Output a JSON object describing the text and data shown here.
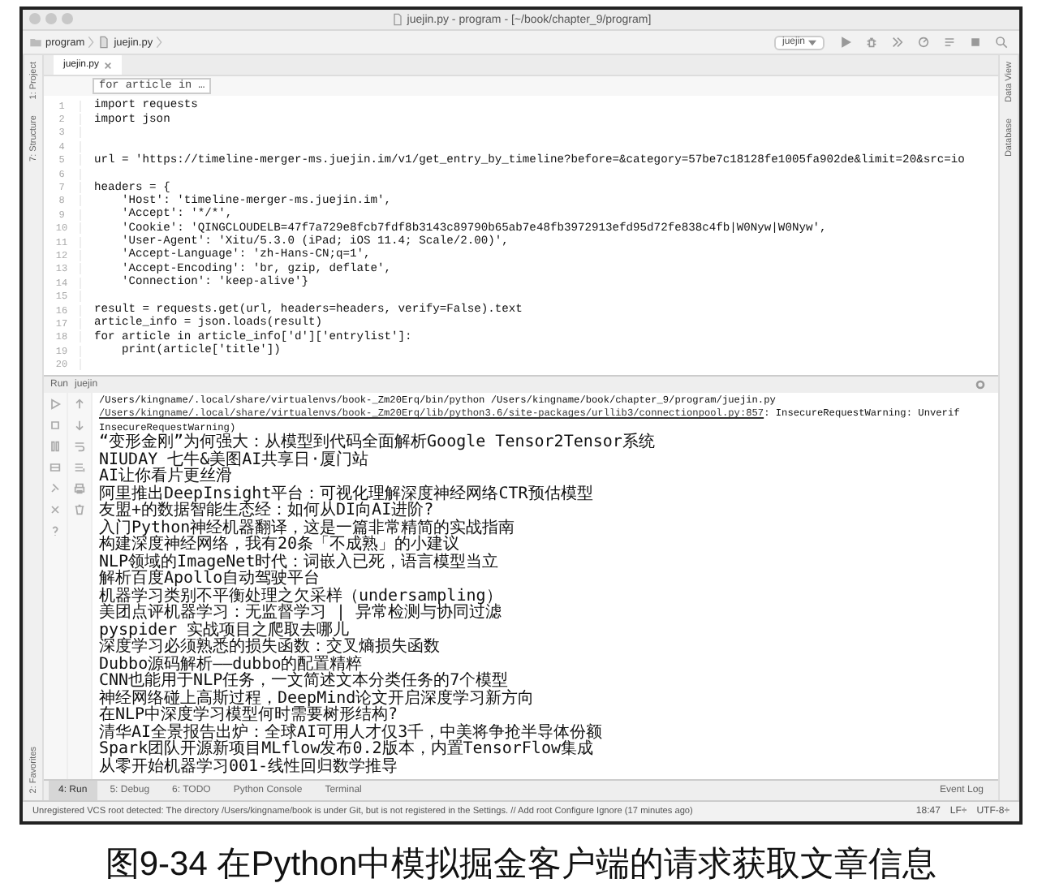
{
  "window": {
    "title": "juejin.py - program - [~/book/chapter_9/program]"
  },
  "breadcrumbs": [
    "program",
    "juejin.py"
  ],
  "run_config": "juejin",
  "left_tool_tabs": [
    "1: Project",
    "7: Structure"
  ],
  "left_bottom_tabs": [
    "2: Favorites"
  ],
  "right_tool_tabs": [
    "Data View",
    "Database"
  ],
  "editor_tabs": [
    {
      "label": "juejin.py",
      "selected": true
    }
  ],
  "breadcrumb_hint": "for article in …",
  "code_lines": [
    {
      "number": "1",
      "text": "import requests"
    },
    {
      "number": "2",
      "text": "import json"
    },
    {
      "number": "3"
    },
    {
      "number": "4"
    },
    {
      "number": "5",
      "text": "url = 'https://timeline-merger-ms.juejin.im/v1/get_entry_by_timeline?before=&category=57be7c18128fe1005fa902de&limit=20&src=io"
    },
    {
      "number": "6"
    },
    {
      "number": "7",
      "text": "headers = {"
    },
    {
      "number": "8",
      "text": "    'Host': 'timeline-merger-ms.juejin.im',"
    },
    {
      "number": "9",
      "text": "    'Accept': '*/*',"
    },
    {
      "number": "10",
      "text": "    'Cookie': 'QINGCLOUDELB=47f7a729e8fcb7fdf8b3143c89790b65ab7e48fb3972913efd95d72fe838c4fb|W0Nyw|W0Nyw',"
    },
    {
      "number": "11",
      "text": "    'User-Agent': 'Xitu/5.3.0 (iPad; iOS 11.4; Scale/2.00)',"
    },
    {
      "number": "12",
      "text": "    'Accept-Language': 'zh-Hans-CN;q=1',"
    },
    {
      "number": "13",
      "text": "    'Accept-Encoding': 'br, gzip, deflate',"
    },
    {
      "number": "14",
      "text": "    'Connection': 'keep-alive'}"
    },
    {
      "number": "15"
    },
    {
      "number": "16",
      "text": "result = requests.get(url, headers=headers, verify=False).text"
    },
    {
      "number": "17",
      "text": "article_info = json.loads(result)"
    },
    {
      "number": "18",
      "text": "for article in article_info['d']['entrylist']:"
    },
    {
      "number": "19",
      "text": "    print(article['title'])"
    },
    {
      "number": "20"
    }
  ],
  "run_panel": {
    "title": "Run",
    "config": "juejin",
    "output": [
      {
        "kind": "command",
        "text": "/Users/kingname/.local/share/virtualenvs/book-_Zm20Erq/bin/python /Users/kingname/book/chapter_9/program/juejin.py"
      },
      {
        "kind": "warning",
        "link": "/Users/kingname/.local/share/virtualenvs/book-_Zm20Erq/lib/python3.6/site-packages/urllib3/connectionpool.py:857",
        "text": ": InsecureRequestWarning: Unverif"
      },
      {
        "kind": "command",
        "text": "  InsecureRequestWarning)"
      },
      {
        "kind": "plain",
        "text": "“变形金刚”为何强大：从模型到代码全面解析Google Tensor2Tensor系统"
      },
      {
        "kind": "plain",
        "text": "NIUDAY 七牛&美图AI共享日·厦门站"
      },
      {
        "kind": "plain",
        "text": "AI让你看片更丝滑"
      },
      {
        "kind": "plain",
        "text": "阿里推出DeepInsight平台：可视化理解深度神经网络CTR预估模型"
      },
      {
        "kind": "plain",
        "text": "友盟+的数据智能生态经：如何从DI向AI进阶?"
      },
      {
        "kind": "plain",
        "text": "入门Python神经机器翻译，这是一篇非常精简的实战指南"
      },
      {
        "kind": "plain",
        "text": "构建深度神经网络，我有20条「不成熟」的小建议"
      },
      {
        "kind": "plain",
        "text": "NLP领域的ImageNet时代：词嵌入已死，语言模型当立"
      },
      {
        "kind": "plain",
        "text": "解析百度Apollo自动驾驶平台"
      },
      {
        "kind": "plain",
        "text": "机器学习类别不平衡处理之欠采样（undersampling）"
      },
      {
        "kind": "plain",
        "text": "美团点评机器学习：无监督学习 | 异常检测与协同过滤"
      },
      {
        "kind": "plain",
        "text": "pyspider 实战项目之爬取去哪儿"
      },
      {
        "kind": "plain",
        "text": "深度学习必须熟悉的损失函数：交叉熵损失函数"
      },
      {
        "kind": "plain",
        "text": "Dubbo源码解析——dubbo的配置精粹"
      },
      {
        "kind": "plain",
        "text": "CNN也能用于NLP任务，一文简述文本分类任务的7个模型"
      },
      {
        "kind": "plain",
        "text": "神经网络碰上高斯过程，DeepMind论文开启深度学习新方向"
      },
      {
        "kind": "plain",
        "text": "在NLP中深度学习模型何时需要树形结构?"
      },
      {
        "kind": "plain",
        "text": "清华AI全景报告出炉：全球AI可用人才仅3千，中美将争抢半导体份额"
      },
      {
        "kind": "plain",
        "text": "Spark团队开源新项目MLflow发布0.2版本，内置TensorFlow集成"
      },
      {
        "kind": "plain",
        "text": "从零开始机器学习001-线性回归数学推导"
      }
    ]
  },
  "tool_windows": [
    {
      "label": "4: Run",
      "selected": true
    },
    {
      "label": "5: Debug",
      "selected": false
    },
    {
      "label": "6: TODO",
      "selected": false
    },
    {
      "label": "Python Console",
      "selected": false
    },
    {
      "label": "Terminal",
      "selected": false
    }
  ],
  "event_log": "Event Log",
  "status_bar": {
    "message": "Unregistered VCS root detected: The directory /Users/kingname/book is under Git, but is not registered in the Settings. // Add root  Configure  Ignore (17 minutes ago)",
    "position": "18:47",
    "line_separator": "LF÷",
    "encoding": "UTF-8÷"
  },
  "caption": "图9-34 在Python中模拟掘金客户端的请求获取文章信息"
}
